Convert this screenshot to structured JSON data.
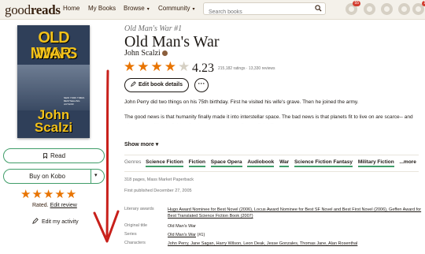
{
  "nav": {
    "logo_light": "good",
    "logo_bold": "reads",
    "home": "Home",
    "my_books": "My Books",
    "browse": "Browse",
    "community": "Community",
    "search_placeholder": "Search books",
    "badge_notifications": "55",
    "badge_messages": "1",
    "caret": "▾"
  },
  "cover": {
    "title_line1": "OLD MAN'S",
    "title_line2": "WAR",
    "author_line1": "John",
    "author_line2": "Scalzi",
    "blurb": "NEW YORK TIMES BESTSELLING AUTHOR"
  },
  "actions": {
    "read_label": "Read",
    "buy_label": "Buy on Kobo",
    "user_stars": "★★★★★",
    "rated_label": "Rated.",
    "edit_review": "Edit review",
    "edit_activity": "Edit my activity"
  },
  "book": {
    "series": "Old Man's War #1",
    "title": "Old Man's War",
    "author": "John Scalzi",
    "avg_rating": "4.23",
    "rating_value": 4.23,
    "counts": "215,182 ratings · 13,330 reviews",
    "edit_details": "Edit book details",
    "more": "···",
    "desc_p1": "John Perry did two things on his 75th birthday. First he visited his wife's grave. Then he joined the army.",
    "desc_p2": "The good news is that humanity finally made it into interstellar space. The bad news is that planets fit to live on are scarce-- and alien races willing to fight us for them are common. So: we fight. To",
    "show_more": "Show more",
    "genres_label": "Genres",
    "genres": [
      "Science Fiction",
      "Fiction",
      "Space Opera",
      "Audiobook",
      "War",
      "Science Fiction Fantasy",
      "Military Fiction"
    ],
    "genres_more": "...more",
    "pages": "318 pages, Mass Market Paperback",
    "published": "First published December 27, 2005",
    "details": {
      "awards_key": "Literary awards",
      "awards_val": "Hugo Award Nominee for Best Novel (2006), Locus Award Nominee for Best SF Novel and Best First Novel (2006), Geffen Award for Best Translated Science Fiction Book (2007)",
      "original_title_key": "Original title",
      "original_title_val": "Old Man's War",
      "series_key": "Series",
      "series_val": "Old Man's War",
      "series_num": "(#1)",
      "characters_key": "Characters",
      "characters_val": "John Perry, Jane Sagan, Harry Wilson, Leon Deak, Jesse Gonzales, Thomas Jane, Alan Rosenthal"
    }
  },
  "colors": {
    "nav_bg": "#f4f1ea",
    "star": "#e87400",
    "green": "#409d69",
    "annotation_arrow": "#c8201b"
  }
}
